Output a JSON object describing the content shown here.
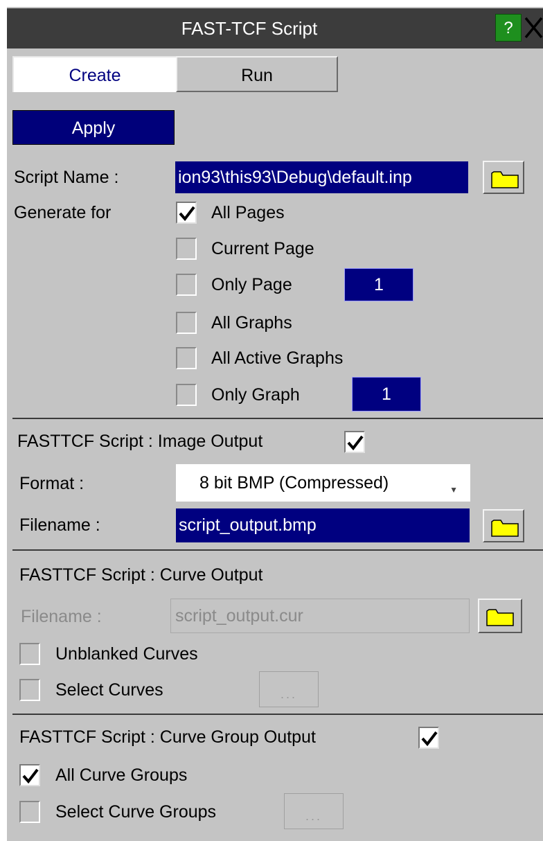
{
  "window": {
    "title": "FAST-TCF Script",
    "help_label": "?"
  },
  "tabs": [
    {
      "label": "Create",
      "active": true
    },
    {
      "label": "Run",
      "active": false
    }
  ],
  "apply_label": "Apply",
  "script_name": {
    "label": "Script Name :",
    "value": "ion93\\this93\\Debug\\default.inp"
  },
  "generate_for": {
    "label": "Generate for",
    "options": [
      {
        "label": "All Pages",
        "checked": true
      },
      {
        "label": "Current Page",
        "checked": false
      },
      {
        "label": "Only Page",
        "checked": false,
        "value": "1"
      },
      {
        "label": "All Graphs",
        "checked": false
      },
      {
        "label": "All Active Graphs",
        "checked": false
      },
      {
        "label": "Only Graph",
        "checked": false,
        "value": "1"
      }
    ]
  },
  "image_output": {
    "heading": "FASTTCF Script : Image Output",
    "enabled": true,
    "format_label": "Format :",
    "format_value": "8 bit BMP (Compressed)",
    "filename_label": "Filename :",
    "filename_value": "script_output.bmp"
  },
  "curve_output": {
    "heading": "FASTTCF Script : Curve Output",
    "filename_label": "Filename :",
    "filename_value": "script_output.cur",
    "unblanked_label": "Unblanked Curves",
    "unblanked_checked": false,
    "select_label": "Select Curves",
    "select_checked": false,
    "dots_label": "..."
  },
  "curve_group_output": {
    "heading": "FASTTCF Script : Curve Group Output",
    "enabled": true,
    "all_label": "All Curve Groups",
    "all_checked": true,
    "select_label": "Select Curve Groups",
    "select_checked": false,
    "dots_label": "..."
  },
  "colors": {
    "panel": "#c4c4c4",
    "navy": "#000080",
    "title_bar": "#3c3c3c",
    "help": "#1e8f1e",
    "folder": "#ffff00"
  }
}
